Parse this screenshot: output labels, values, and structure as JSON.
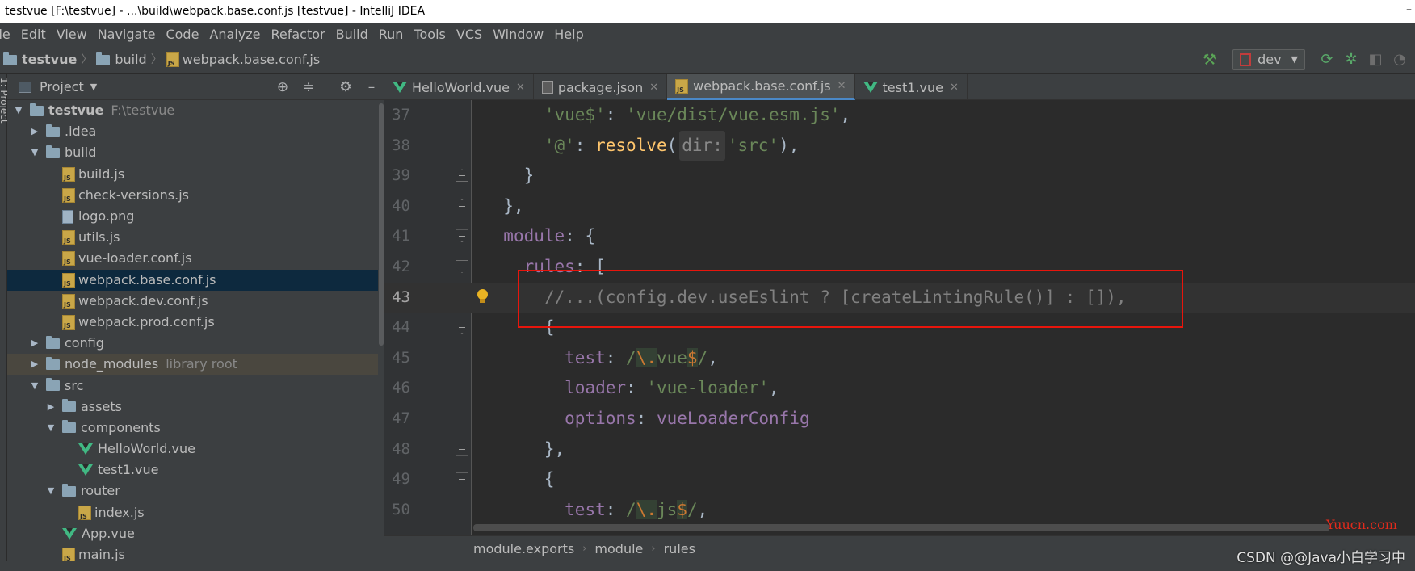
{
  "window": {
    "title": "testvue [F:\\testvue] - ...\\build\\webpack.base.conf.js [testvue] - IntelliJ IDEA",
    "minimize_glyph": "–"
  },
  "menu": [
    "ile",
    "Edit",
    "View",
    "Navigate",
    "Code",
    "Analyze",
    "Refactor",
    "Build",
    "Run",
    "Tools",
    "VCS",
    "Window",
    "Help"
  ],
  "breadcrumb": [
    "testvue",
    "build",
    "webpack.base.conf.js"
  ],
  "toolbar": {
    "run_config": "dev",
    "icons": [
      "hammer-icon",
      "run-config-icon",
      "rerun-icon",
      "debug-icon",
      "coverage-icon",
      "profile-icon"
    ]
  },
  "strip_label": "1: Project",
  "project_panel": {
    "title": "Project",
    "header_icons": [
      "target-icon",
      "collapse-icon",
      "settings-icon",
      "hide-icon"
    ],
    "tree": [
      {
        "label": "testvue",
        "hint": "F:\\testvue",
        "depth": 0,
        "arrow": "open",
        "icon": "folder",
        "bold": true
      },
      {
        "label": ".idea",
        "depth": 1,
        "arrow": "closed",
        "icon": "folder"
      },
      {
        "label": "build",
        "depth": 1,
        "arrow": "open",
        "icon": "folder"
      },
      {
        "label": "build.js",
        "depth": 2,
        "arrow": "none",
        "icon": "js"
      },
      {
        "label": "check-versions.js",
        "depth": 2,
        "arrow": "none",
        "icon": "js"
      },
      {
        "label": "logo.png",
        "depth": 2,
        "arrow": "none",
        "icon": "image"
      },
      {
        "label": "utils.js",
        "depth": 2,
        "arrow": "none",
        "icon": "js"
      },
      {
        "label": "vue-loader.conf.js",
        "depth": 2,
        "arrow": "none",
        "icon": "js"
      },
      {
        "label": "webpack.base.conf.js",
        "depth": 2,
        "arrow": "none",
        "icon": "js",
        "selected": true
      },
      {
        "label": "webpack.dev.conf.js",
        "depth": 2,
        "arrow": "none",
        "icon": "js"
      },
      {
        "label": "webpack.prod.conf.js",
        "depth": 2,
        "arrow": "none",
        "icon": "js"
      },
      {
        "label": "config",
        "depth": 1,
        "arrow": "closed",
        "icon": "folder"
      },
      {
        "label": "node_modules",
        "hint": "library root",
        "depth": 1,
        "arrow": "closed",
        "icon": "folder",
        "library": true
      },
      {
        "label": "src",
        "depth": 1,
        "arrow": "open",
        "icon": "folder"
      },
      {
        "label": "assets",
        "depth": 2,
        "arrow": "closed",
        "icon": "folder"
      },
      {
        "label": "components",
        "depth": 2,
        "arrow": "open",
        "icon": "folder"
      },
      {
        "label": "HelloWorld.vue",
        "depth": 3,
        "arrow": "none",
        "icon": "vue"
      },
      {
        "label": "test1.vue",
        "depth": 3,
        "arrow": "none",
        "icon": "vue"
      },
      {
        "label": "router",
        "depth": 2,
        "arrow": "open",
        "icon": "folder"
      },
      {
        "label": "index.js",
        "depth": 3,
        "arrow": "none",
        "icon": "js"
      },
      {
        "label": "App.vue",
        "depth": 2,
        "arrow": "none",
        "icon": "vue"
      },
      {
        "label": "main.js",
        "depth": 2,
        "arrow": "none",
        "icon": "js"
      }
    ]
  },
  "tabs": [
    {
      "label": "HelloWorld.vue",
      "icon": "vue",
      "active": false
    },
    {
      "label": "package.json",
      "icon": "package",
      "active": false
    },
    {
      "label": "webpack.base.conf.js",
      "icon": "js",
      "active": true
    },
    {
      "label": "test1.vue",
      "icon": "vue",
      "active": false
    }
  ],
  "code_lines": [
    {
      "num": "37",
      "fold": "",
      "segments": [
        [
          "",
          "      "
        ],
        [
          "str",
          "'vue$'"
        ],
        [
          "",
          ": "
        ],
        [
          "str",
          "'vue/dist/vue.esm.js'"
        ],
        [
          "",
          ","
        ]
      ]
    },
    {
      "num": "38",
      "fold": "",
      "segments": [
        [
          "",
          "      "
        ],
        [
          "str",
          "'@'"
        ],
        [
          "",
          ": "
        ],
        [
          "fn",
          "resolve"
        ],
        [
          "",
          "("
        ],
        [
          "hint",
          "dir:"
        ],
        [
          "str",
          "'src'"
        ],
        [
          "",
          "),"
        ]
      ]
    },
    {
      "num": "39",
      "fold": "open",
      "segments": [
        [
          "",
          "    }"
        ]
      ]
    },
    {
      "num": "40",
      "fold": "open",
      "segments": [
        [
          "",
          "  },"
        ]
      ]
    },
    {
      "num": "41",
      "fold": "close",
      "segments": [
        [
          "",
          "  "
        ],
        [
          "key",
          "module"
        ],
        [
          "",
          ": {"
        ]
      ]
    },
    {
      "num": "42",
      "fold": "close",
      "segments": [
        [
          "",
          "    "
        ],
        [
          "key",
          "rules"
        ],
        [
          "",
          ": ["
        ]
      ]
    },
    {
      "num": "43",
      "fold": "",
      "current": true,
      "bulb": true,
      "segments": [
        [
          "",
          "      "
        ],
        [
          "cmt",
          "//...(config.dev.useEslint ? [createLintingRule()] : []),"
        ]
      ]
    },
    {
      "num": "44",
      "fold": "close",
      "segments": [
        [
          "",
          "      {"
        ]
      ]
    },
    {
      "num": "45",
      "fold": "",
      "segments": [
        [
          "",
          "        "
        ],
        [
          "key",
          "test"
        ],
        [
          "",
          ": "
        ],
        [
          "rx",
          "/"
        ],
        [
          "rxe",
          "\\."
        ],
        [
          "rx",
          "vue"
        ],
        [
          "rxe",
          "$"
        ],
        [
          "rx",
          "/"
        ],
        [
          "",
          ","
        ]
      ]
    },
    {
      "num": "46",
      "fold": "",
      "segments": [
        [
          "",
          "        "
        ],
        [
          "key",
          "loader"
        ],
        [
          "",
          ": "
        ],
        [
          "str",
          "'vue-loader'"
        ],
        [
          "",
          ","
        ]
      ]
    },
    {
      "num": "47",
      "fold": "",
      "segments": [
        [
          "",
          "        "
        ],
        [
          "key",
          "options"
        ],
        [
          "",
          ": "
        ],
        [
          "var",
          "vueLoaderConfig"
        ]
      ]
    },
    {
      "num": "48",
      "fold": "open",
      "segments": [
        [
          "",
          "      },"
        ]
      ]
    },
    {
      "num": "49",
      "fold": "close",
      "segments": [
        [
          "",
          "      {"
        ]
      ]
    },
    {
      "num": "50",
      "fold": "",
      "segments": [
        [
          "",
          "        "
        ],
        [
          "key",
          "test"
        ],
        [
          "",
          ": "
        ],
        [
          "rx",
          "/"
        ],
        [
          "rxe",
          "\\."
        ],
        [
          "rx",
          "js"
        ],
        [
          "rxe",
          "$"
        ],
        [
          "rx",
          "/"
        ],
        [
          "",
          ","
        ]
      ]
    }
  ],
  "status_breadcrumb": [
    "module.exports",
    "module",
    "rules"
  ],
  "watermarks": {
    "site": "Yuucn.com",
    "csdn": "CSDN @@Java小白学习中"
  }
}
